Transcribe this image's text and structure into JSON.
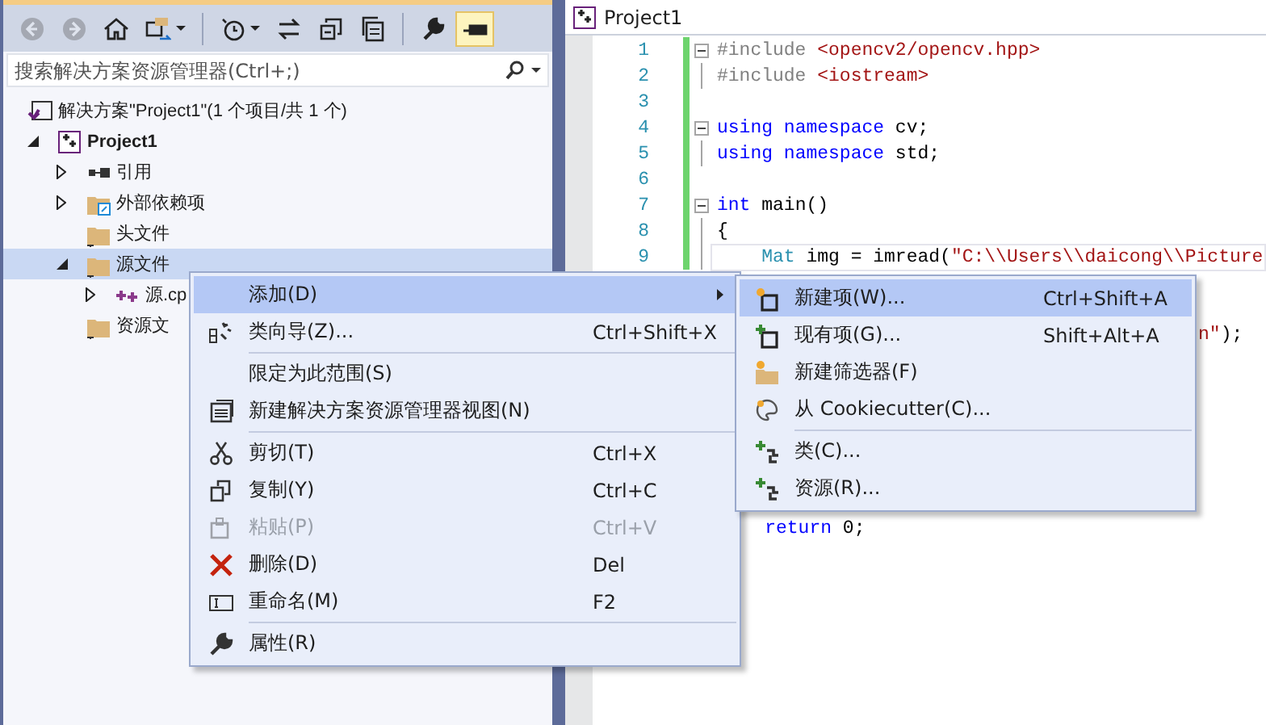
{
  "toolbar": [
    {
      "kind": "back",
      "disabled": true,
      "on": false
    },
    {
      "kind": "forward",
      "disabled": true,
      "on": false
    },
    {
      "kind": "home",
      "disabled": false,
      "on": false
    },
    {
      "kind": "sync-view",
      "disabled": false,
      "on": false,
      "dropdown": true
    },
    {
      "kind": "separator"
    },
    {
      "kind": "history",
      "disabled": false,
      "on": false,
      "dropdown": true
    },
    {
      "kind": "sync",
      "disabled": false,
      "on": false
    },
    {
      "kind": "collapse",
      "disabled": false,
      "on": false
    },
    {
      "kind": "view",
      "disabled": false,
      "on": false
    },
    {
      "kind": "separator"
    },
    {
      "kind": "wrench",
      "disabled": false,
      "on": false
    },
    {
      "kind": "pin",
      "disabled": false,
      "on": true
    }
  ],
  "search": {
    "placeholder": "搜索解决方案资源管理器(Ctrl+;)"
  },
  "tree": [
    {
      "label": "解决方案\"Project1\"(1 个项目/共 1 个)",
      "kind": "solution",
      "selected": false,
      "children": [
        {
          "label": "Project1",
          "kind": "project",
          "selected": false,
          "expanded": true,
          "children": [
            {
              "label": "引用",
              "kind": "references",
              "selected": false,
              "expanded": false
            },
            {
              "label": "外部依赖项",
              "kind": "external",
              "selected": false,
              "expanded": false
            },
            {
              "label": "头文件",
              "kind": "folder",
              "selected": false
            },
            {
              "label": "源文件",
              "kind": "folder",
              "selected": true,
              "expanded": true,
              "children": [
                {
                  "label": "源.cp",
                  "kind": "cpp",
                  "selected": false,
                  "expanded": false
                }
              ]
            },
            {
              "label": "资源文",
              "kind": "folder",
              "selected": false
            }
          ]
        }
      ]
    }
  ],
  "editor": {
    "title": "Project1",
    "lines": [
      {
        "kind": "line",
        "number": "1",
        "expanded": true,
        "current": false,
        "tokens": [
          {
            "text": "#include",
            "kind": "directive"
          },
          {
            "text": " <opencv2/opencv.hpp>",
            "kind": "string"
          }
        ]
      },
      {
        "kind": "line",
        "number": "2",
        "current": false,
        "tokens": [
          {
            "text": "#include",
            "kind": "directive"
          },
          {
            "text": " <iostream>",
            "kind": "string"
          }
        ]
      },
      {
        "kind": "line",
        "number": "3",
        "current": false
      },
      {
        "kind": "line",
        "number": "4",
        "expanded": true,
        "current": false,
        "tokens": [
          {
            "text": "using",
            "kind": "keyword"
          },
          {
            "text": " namespace",
            "kind": "keyword"
          },
          {
            "text": " cv;",
            "kind": "plain"
          }
        ]
      },
      {
        "kind": "line",
        "number": "5",
        "current": false,
        "tokens": [
          {
            "text": "using",
            "kind": "keyword"
          },
          {
            "text": " namespace",
            "kind": "keyword"
          },
          {
            "text": " std;",
            "kind": "plain"
          }
        ]
      },
      {
        "kind": "line",
        "number": "6",
        "current": false
      },
      {
        "kind": "line",
        "number": "7",
        "expanded": true,
        "current": false,
        "tokens": [
          {
            "text": "int",
            "kind": "keyword"
          },
          {
            "text": " main()",
            "kind": "plain"
          }
        ]
      },
      {
        "kind": "line",
        "number": "8",
        "current": false,
        "tokens": [
          {
            "text": "{",
            "kind": "plain"
          }
        ]
      },
      {
        "kind": "line",
        "number": "9",
        "current": true,
        "tokens": [
          {
            "text": "    Mat",
            "kind": "type"
          },
          {
            "text": " img = imread(",
            "kind": "plain"
          },
          {
            "text": "\"C:\\\\Users\\\\daicong\\\\Picture",
            "kind": "string"
          }
        ]
      },
      {
        "kind": "tail",
        "current": false,
        "tokens": [
          {
            "text": "n\"",
            "kind": "string"
          },
          {
            "text": ");",
            "kind": "plain"
          }
        ]
      },
      {
        "kind": "closing",
        "current": false,
        "tokens": [
          {
            "text": "    return",
            "kind": "keyword"
          },
          {
            "text": " 0;",
            "kind": "plain"
          }
        ]
      }
    ]
  },
  "context_menu": {
    "items": [
      {
        "kind": "item",
        "label": "添加(D)",
        "selected": true,
        "disabled": false,
        "submenu": true
      },
      {
        "kind": "item",
        "label": "类向导(Z)...",
        "shortcut": "Ctrl+Shift+X",
        "selected": false,
        "disabled": false
      },
      {
        "kind": "separator"
      },
      {
        "kind": "item",
        "label": "限定为此范围(S)",
        "selected": false,
        "disabled": false
      },
      {
        "kind": "item",
        "label": "新建解决方案资源管理器视图(N)",
        "selected": false,
        "disabled": false
      },
      {
        "kind": "separator"
      },
      {
        "kind": "item",
        "label": "剪切(T)",
        "shortcut": "Ctrl+X",
        "selected": false,
        "disabled": false
      },
      {
        "kind": "item",
        "label": "复制(Y)",
        "shortcut": "Ctrl+C",
        "selected": false,
        "disabled": false
      },
      {
        "kind": "item",
        "label": "粘贴(P)",
        "shortcut": "Ctrl+V",
        "selected": false,
        "disabled": true
      },
      {
        "kind": "item",
        "label": "删除(D)",
        "shortcut": "Del",
        "selected": false,
        "disabled": false
      },
      {
        "kind": "item",
        "label": "重命名(M)",
        "shortcut": "F2",
        "selected": false,
        "disabled": false
      },
      {
        "kind": "separator"
      },
      {
        "kind": "item",
        "label": "属性(R)",
        "selected": false,
        "disabled": false
      }
    ]
  },
  "submenu": {
    "items": [
      {
        "kind": "item",
        "label": "新建项(W)...",
        "shortcut": "Ctrl+Shift+A",
        "selected": true,
        "disabled": false
      },
      {
        "kind": "item",
        "label": "现有项(G)...",
        "shortcut": "Shift+Alt+A",
        "selected": false,
        "disabled": false
      },
      {
        "kind": "item",
        "label": "新建筛选器(F)",
        "selected": false,
        "disabled": false
      },
      {
        "kind": "item",
        "label": "从 Cookiecutter(C)...",
        "selected": false,
        "disabled": false
      },
      {
        "kind": "separator"
      },
      {
        "kind": "item",
        "label": "类(C)...",
        "selected": false,
        "disabled": false
      },
      {
        "kind": "item",
        "label": "资源(R)...",
        "selected": false,
        "disabled": false
      }
    ]
  }
}
